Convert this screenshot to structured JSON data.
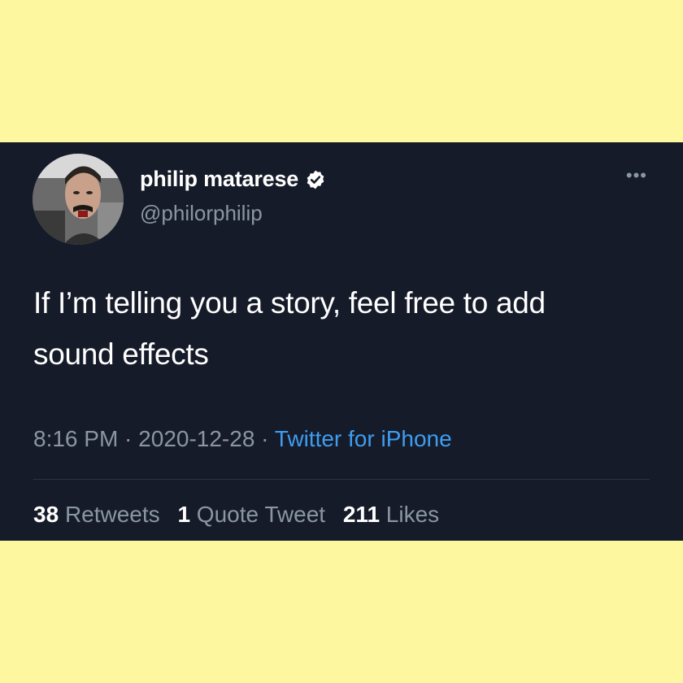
{
  "colors": {
    "page_background": "#fdf8a0",
    "card_background": "#161b29",
    "primary_text": "#ffffff",
    "secondary_text": "#8a96a3",
    "link": "#3e9df0"
  },
  "tweet": {
    "display_name": "philip matarese",
    "verified_icon": "verified-badge-icon",
    "handle": "@philorphilip",
    "more_icon": "more-options-icon",
    "more_glyph": "•••",
    "text_line1": "If I’m telling you a story, feel free to add",
    "text_line2": "sound effects",
    "time": "8:16 PM",
    "sep1": " · ",
    "date": "2020-12-28",
    "sep2": " · ",
    "source": "Twitter for iPhone",
    "stats": {
      "retweets_count": "38",
      "retweets_label": "Retweets",
      "quotes_count": "1",
      "quotes_label": "Quote Tweet",
      "likes_count": "211",
      "likes_label": "Likes"
    }
  }
}
